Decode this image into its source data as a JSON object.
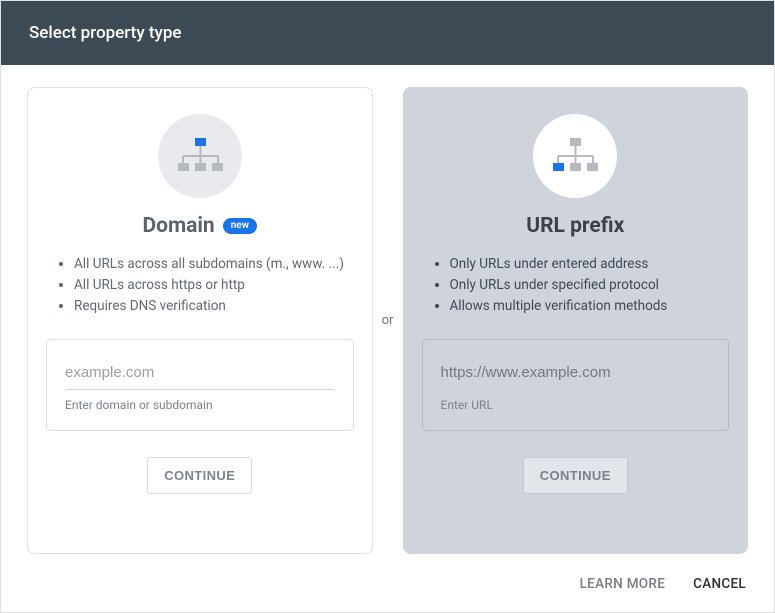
{
  "header": {
    "title": "Select property type"
  },
  "separator": "or",
  "cards": {
    "domain": {
      "title": "Domain",
      "badge": "new",
      "features": [
        "All URLs across all subdomains (m., www. ...)",
        "All URLs across https or http",
        "Requires DNS verification"
      ],
      "input_placeholder": "example.com",
      "helper": "Enter domain or subdomain",
      "continue": "CONTINUE"
    },
    "url_prefix": {
      "title": "URL prefix",
      "features": [
        "Only URLs under entered address",
        "Only URLs under specified protocol",
        "Allows multiple verification methods"
      ],
      "input_placeholder": "https://www.example.com",
      "helper": "Enter URL",
      "continue": "CONTINUE"
    }
  },
  "footer": {
    "learn_more": "LEARN MORE",
    "cancel": "CANCEL"
  }
}
